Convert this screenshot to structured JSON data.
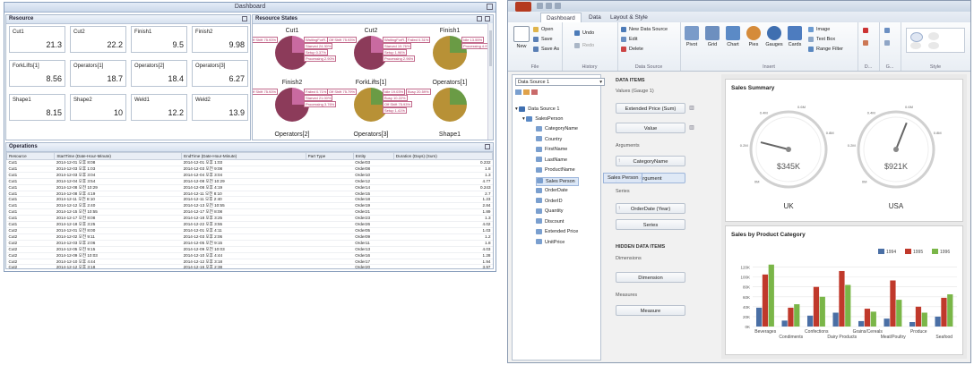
{
  "left": {
    "title": "Dashboard",
    "resource_pane": {
      "title": "Resource",
      "cards": [
        {
          "name": "Cut1",
          "value": "21.3"
        },
        {
          "name": "Cut2",
          "value": "22.2"
        },
        {
          "name": "Finish1",
          "value": "9.5"
        },
        {
          "name": "Finish2",
          "value": "9.98"
        },
        {
          "name": "ForkLifts[1]",
          "value": "8.56"
        },
        {
          "name": "Operators[1]",
          "value": "18.7"
        },
        {
          "name": "Operators[2]",
          "value": "18.4"
        },
        {
          "name": "Operators[3]",
          "value": "6.27"
        },
        {
          "name": "Shape1",
          "value": "8.15"
        },
        {
          "name": "Shape2",
          "value": "10"
        },
        {
          "name": "Weld1",
          "value": "12.2"
        },
        {
          "name": "Weld2",
          "value": "13.9"
        }
      ]
    },
    "states_pane": {
      "title": "Resource States",
      "pies": [
        {
          "label": "Cut1",
          "callouts": [
            "Off Shift 75.93%",
            "WaitingForR... 0.00%",
            "Starved 24.30%",
            "Setup 0.37%",
            "Processing 2.90%"
          ]
        },
        {
          "label": "Cut2",
          "callouts": [
            "Off Shift 75.93%",
            "WaitingForR... 0.00%",
            "Starved 19.76%",
            "Setup 1.96%",
            "Processing 2.96%"
          ]
        },
        {
          "label": "Finish1",
          "callouts": [
            "Failed 0.31%",
            "Idle 13.55%",
            "Processing 4.97%"
          ]
        },
        {
          "label": "Finish2",
          "callouts": [
            "Off Shift 75.93%",
            "Failed 0.71%",
            "Starved 21.00%",
            "Processing 3.76%"
          ]
        },
        {
          "label": "ForkLifts[1]",
          "callouts": [
            "Off Shift 75.79%",
            "Idle 19.03%",
            "Busy 10.22%",
            "Off Shift 75.93%",
            "Setup 1.41%"
          ]
        },
        {
          "label": "Operators[1]",
          "callouts": [
            "Busy 20.59%"
          ]
        },
        {
          "label": "Operators[2]",
          "callouts": []
        },
        {
          "label": "Operators[3]",
          "callouts": []
        },
        {
          "label": "Shape1",
          "callouts": []
        }
      ]
    },
    "operations_pane": {
      "title": "Operations",
      "columns": [
        "Resource",
        "StartTime (Date-Hour-Minute)",
        "EndTime (Date-Hour-Minute)",
        "Part Type",
        "Entity",
        "Duration (Days) (Sum)"
      ],
      "rows": [
        [
          "Cut1",
          "2014-12-01 오후 8:08",
          "2014-12-01 오후 1:03",
          "",
          "Order03",
          "0.232"
        ],
        [
          "Cut1",
          "2014-12-03 오후 1:03",
          "2014-12-03 오전 9:08",
          "",
          "Order08",
          "1.8"
        ],
        [
          "Cut1",
          "2014-12-03 오후 3:04",
          "2014-12-04 오후 3:04",
          "",
          "Order10",
          "1.3"
        ],
        [
          "Cut1",
          "2014-12-04 오후 3:54",
          "2014-12-08 오전 10:29",
          "",
          "Order12",
          "4.77"
        ],
        [
          "Cut1",
          "2014-12-08 오전 10:29",
          "2014-12-08 오후 4:19",
          "",
          "Order14",
          "0.243"
        ],
        [
          "Cut1",
          "2014-12-08 오후 4:19",
          "2014-12-11 오전 8:10",
          "",
          "Order15",
          "2.7"
        ],
        [
          "Cut1",
          "2014-12-11 오전 8:10",
          "2014-12-11 오후 2:40",
          "",
          "Order18",
          "1.23"
        ],
        [
          "Cut1",
          "2014-12-12 오후 2:40",
          "2014-12-13 오전 10:55",
          "",
          "Order19",
          "2.84"
        ],
        [
          "Cut1",
          "2014-12-15 오전 10:55",
          "2014-12-17 오전 8:08",
          "",
          "Order21",
          "1.89"
        ],
        [
          "Cut1",
          "2014-12-17 오전 8:08",
          "2014-12-18 오후 3:25",
          "",
          "Order23",
          "1.3"
        ],
        [
          "Cut1",
          "2014-12-18 오후 3:25",
          "2014-12-22 오후 3:55",
          "",
          "Order26",
          "4.02"
        ],
        [
          "Cut2",
          "2014-12-01 오전 8:00",
          "2014-12-01 오후 4:11",
          "",
          "Order05",
          "1.03"
        ],
        [
          "Cut2",
          "2014-12-02 오전 9:11",
          "2014-12-03 오후 2:06",
          "",
          "Order09",
          "1.2"
        ],
        [
          "Cut2",
          "2014-12-03 오후 2:06",
          "2014-12-05 오전 9:15",
          "",
          "Order11",
          "1.8"
        ],
        [
          "Cut2",
          "2014-12-05 오전 9:15",
          "2014-12-09 오전 10:03",
          "",
          "Order13",
          "4.03"
        ],
        [
          "Cut2",
          "2014-12-09 오전 10:03",
          "2014-12-10 오후 4:44",
          "",
          "Order16",
          "1.28"
        ],
        [
          "Cut2",
          "2014-12-10 오후 4:44",
          "2014-12-12 오후 3:18",
          "",
          "Order17",
          "1.94"
        ],
        [
          "Cut2",
          "2014-12-12 오후 3:18",
          "2014-12-16 오후 2:38",
          "",
          "Order20",
          "3.97"
        ]
      ]
    }
  },
  "right": {
    "tabs": [
      "Dashboard",
      "Data",
      "Layout & Style"
    ],
    "ribbon": {
      "file": {
        "label": "File",
        "new": "New",
        "open": "Open",
        "save": "Save",
        "save_as": "Save As"
      },
      "history": {
        "label": "History",
        "undo": "Undo",
        "redo": "Redo"
      },
      "data_source": {
        "label": "Data Source",
        "new": "New Data Source",
        "edit": "Edit",
        "delete": "Delete"
      },
      "insert": {
        "label": "Insert",
        "pivot": "Pivot",
        "grid": "Grid",
        "chart": "Chart",
        "pies": "Pies",
        "gauges": "Gauges",
        "cards": "Cards",
        "image": "Image",
        "text_box": "Text Box",
        "range_filter": "Range Filter"
      },
      "more_labels": [
        "D...",
        "G...",
        "Style"
      ]
    },
    "tree": {
      "data_source_select": "Data Source 1",
      "root": "Data Source 1",
      "table": "SalesPerson",
      "fields": [
        "CategoryName",
        "Country",
        "FirstName",
        "LastName",
        "ProductName",
        "Sales Person",
        "OrderDate",
        "OrderID",
        "Quantity",
        "Discount",
        "Extended Price",
        "UnitPrice"
      ]
    },
    "data_items": {
      "header": "DATA ITEMS",
      "values_label": "Values (Gauge 1)",
      "values": [
        "Extended Price (Sum)",
        "Value"
      ],
      "arguments_label": "Arguments",
      "arguments": [
        "CategoryName",
        "Argument"
      ],
      "drag_ghost": "Sales Person",
      "series_label": "Series",
      "series": [
        "OrderDate (Year)",
        "Series"
      ],
      "hidden_header": "HIDDEN DATA ITEMS",
      "dimensions_label": "Dimensions",
      "dimension": "Dimension",
      "measures_label": "Measures",
      "measure": "Measure"
    },
    "gauge_panel": {
      "title": "Sales Summary",
      "gauges": [
        {
          "name": "UK",
          "value_text": "$345K",
          "fill": 0.22,
          "ticks": [
            "0M",
            "0.2M",
            "0.4M",
            "0.6M",
            "0.8M"
          ]
        },
        {
          "name": "USA",
          "value_text": "$921K",
          "fill": 0.58,
          "ticks": [
            "0M",
            "0.2M",
            "0.4M",
            "0.6M",
            "0.8M"
          ]
        }
      ]
    },
    "bar_panel": {
      "title": "Sales by Product Category"
    }
  },
  "chart_data": {
    "type": "bar",
    "title": "Sales by Product Category",
    "categories": [
      "Beverages",
      "Condiments",
      "Confections",
      "Dairy Products",
      "Grains/Cereals",
      "Meat/Poultry",
      "Produce",
      "Seafood"
    ],
    "series": [
      {
        "name": "1994",
        "color": "#4a6fa5",
        "values": [
          38000,
          12000,
          22000,
          28000,
          11000,
          16000,
          9000,
          20000
        ]
      },
      {
        "name": "1995",
        "color": "#c0392b",
        "values": [
          105000,
          38000,
          80000,
          112000,
          36000,
          93000,
          40000,
          58000
        ]
      },
      {
        "name": "1996",
        "color": "#7ab648",
        "values": [
          125000,
          45000,
          60000,
          84000,
          30000,
          54000,
          28000,
          65000
        ]
      }
    ],
    "yticks": [
      "0K",
      "20K",
      "40K",
      "60K",
      "80K",
      "100K",
      "120K"
    ],
    "ylim": [
      0,
      130000
    ],
    "legend": "top-right"
  }
}
